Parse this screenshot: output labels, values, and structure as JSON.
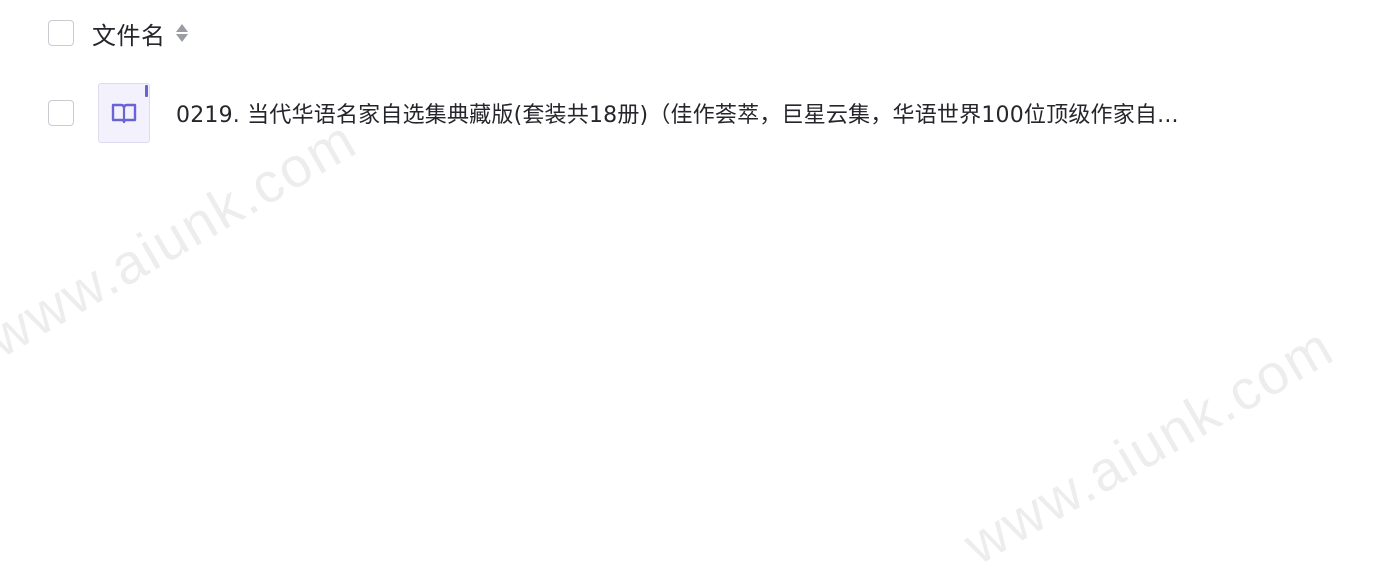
{
  "table": {
    "header": {
      "column_label": "文件名",
      "sort_icon": "sort-icon"
    },
    "rows": [
      {
        "file_icon": "book-icon",
        "name": "0219. 当代华语名家自选集典藏版(套装共18册)（佳作荟萃，巨星云集，华语世界100位顶级作家自..."
      }
    ]
  },
  "watermarks": [
    "www.aiunk.com",
    "www.aiunk.com"
  ],
  "colors": {
    "icon_accent": "#6a63d6",
    "icon_bg": "#f3f2fc",
    "text": "#25262b",
    "checkbox_border": "#c9cbd1"
  }
}
